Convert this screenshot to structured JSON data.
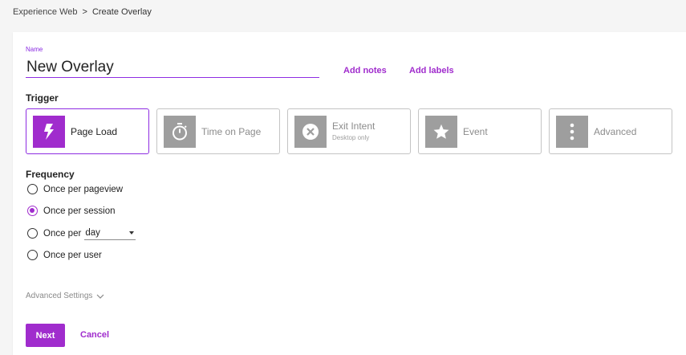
{
  "breadcrumb": {
    "parent": "Experience Web",
    "separator": ">",
    "current": "Create Overlay"
  },
  "form": {
    "name_label": "Name",
    "name_value": "New Overlay",
    "add_notes": "Add notes",
    "add_labels": "Add labels"
  },
  "trigger": {
    "title": "Trigger",
    "options": [
      {
        "label": "Page Load",
        "icon": "lightning-bolt-icon",
        "selected": true
      },
      {
        "label": "Time on Page",
        "icon": "stopwatch-icon",
        "selected": false
      },
      {
        "label": "Exit Intent",
        "sub": "Desktop only",
        "icon": "close-circle-icon",
        "selected": false
      },
      {
        "label": "Event",
        "icon": "star-icon",
        "selected": false
      },
      {
        "label": "Advanced",
        "icon": "more-vertical-icon",
        "selected": false
      }
    ]
  },
  "frequency": {
    "title": "Frequency",
    "options": [
      {
        "label": "Once per pageview",
        "checked": false
      },
      {
        "label": "Once per session",
        "checked": true
      },
      {
        "label": "Once per",
        "checked": false,
        "select_value": "day"
      },
      {
        "label": "Once per user",
        "checked": false
      }
    ]
  },
  "advanced_settings": "Advanced Settings",
  "actions": {
    "next": "Next",
    "cancel": "Cancel"
  },
  "colors": {
    "accent": "#a02ccd",
    "icon_inactive": "#9e9e9e"
  }
}
